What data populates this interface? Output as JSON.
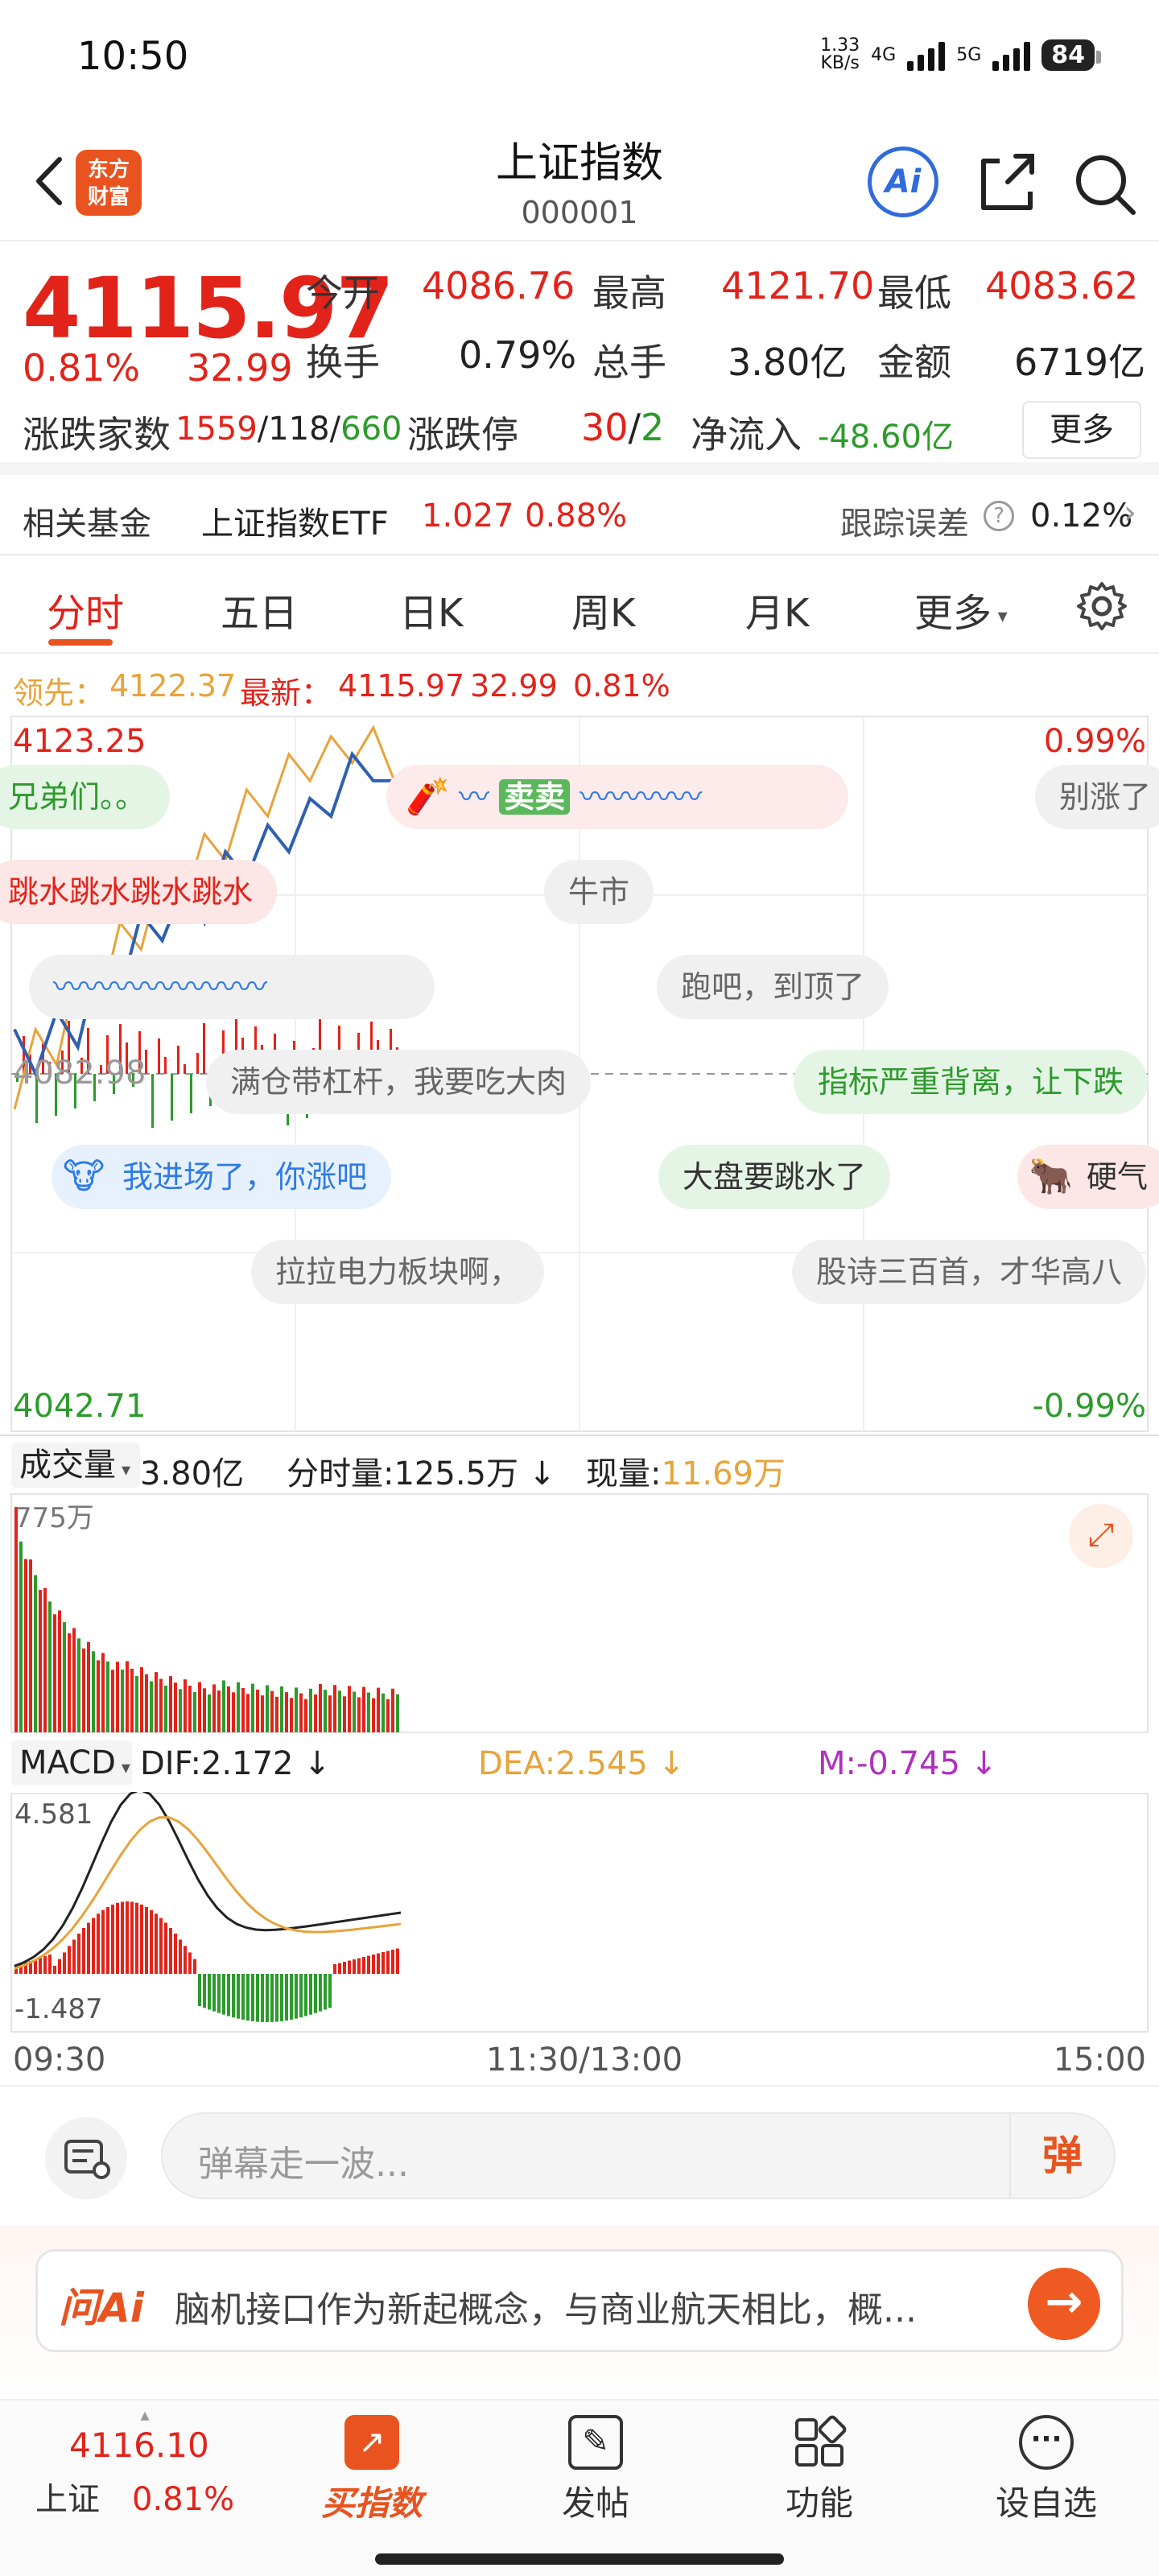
{
  "status_bar": {
    "time": "10:50",
    "net_speed": "1.33",
    "net_unit": "KB/s",
    "net1": "4G",
    "net2": "5G",
    "battery": "84"
  },
  "header": {
    "logo_line1": "东方",
    "logo_line2": "财富",
    "title": "上证指数",
    "code": "000001",
    "ai_label": "Ai"
  },
  "quote": {
    "price": "4115.97",
    "change_pct": "0.81%",
    "change": "32.99",
    "open_label": "今开",
    "open": "4086.76",
    "high_label": "最高",
    "high": "4121.70",
    "low_label": "最低",
    "low": "4083.62",
    "turnover_label": "换手",
    "turnover": "0.79%",
    "volume_label": "总手",
    "volume": "3.80亿",
    "amount_label": "金额",
    "amount": "6719亿",
    "breadth_label": "涨跌家数",
    "up": "1559",
    "flat": "118",
    "down": "660",
    "sep": "/",
    "limit_label": "涨跌停",
    "limit_up": "30",
    "limit_down": "2",
    "netflow_label": "净流入",
    "netflow": "-48.60亿",
    "more": "更多"
  },
  "fund": {
    "label": "相关基金",
    "name": "上证指数ETF",
    "price": "1.027",
    "pct": "0.88%",
    "err_label": "跟踪误差",
    "err": "0.12%"
  },
  "tabs": [
    {
      "label": "分时"
    },
    {
      "label": "五日"
    },
    {
      "label": "日K"
    },
    {
      "label": "周K"
    },
    {
      "label": "月K"
    },
    {
      "label": "更多"
    }
  ],
  "legend": {
    "lead_label": "领先：",
    "lead": "4122.37",
    "latest_label": "最新：",
    "latest": "4115.97",
    "chg": "32.99",
    "pct": "0.81%"
  },
  "main_chart": {
    "top": "4123.25",
    "top_pct": "0.99%",
    "mid": "4082.98",
    "bottom": "4042.71",
    "bottom_pct": "-0.99%"
  },
  "danmaku": [
    {
      "text": "兄弟们。。"
    },
    {
      "text": "卖卖"
    },
    {
      "text": "别涨了"
    },
    {
      "text": "跳水跳水跳水跳水"
    },
    {
      "text": "牛市"
    },
    {
      "text": "跑吧，到顶了"
    },
    {
      "text": "满仓带杠杆，我要吃大肉"
    },
    {
      "text": "指标严重背离，让下跌"
    },
    {
      "text": "我进场了，你涨吧"
    },
    {
      "text": "大盘要跳水了"
    },
    {
      "text": "硬气"
    },
    {
      "text": "拉拉电力板块啊，"
    },
    {
      "text": "股诗三百首，才华高八"
    }
  ],
  "volume": {
    "label": "成交量",
    "total": "3.80亿",
    "period_label": "分时量:",
    "period": "125.5万",
    "now_label": "现量:",
    "now": "11.69万",
    "max": "775万"
  },
  "macd": {
    "label": "MACD",
    "dif": "DIF:2.172",
    "dea": "DEA:2.545",
    "m": "M:-0.745",
    "max": "4.581",
    "min": "-1.487"
  },
  "time_axis": {
    "start": "09:30",
    "mid": "11:30/13:00",
    "end": "15:00"
  },
  "comment": {
    "placeholder": "弹幕走一波...",
    "dan": "弹"
  },
  "ai_bar": {
    "tag": "问Ai",
    "text": "脑机接口作为新起概念，与商业航天相比，概..."
  },
  "bottom_nav": {
    "index_price": "4116.10",
    "index_name": "上证",
    "index_pct": "0.81%",
    "buy": "买指数",
    "post": "发帖",
    "func": "功能",
    "watch": "设自选"
  },
  "chart_data": {
    "type": "line",
    "series": [
      {
        "values": [
          4079,
          4088,
          4084,
          4095,
          4090,
          4100,
          4097,
          4106,
          4102,
          4110,
          4107,
          4115,
          4112,
          4119,
          4116,
          4121,
          4118,
          4122,
          4116
        ]
      },
      {
        "values": [
          4088,
          4083,
          4090,
          4086,
          4096,
          4092,
          4101,
          4098,
          4104,
          4100,
          4108,
          4105,
          4111,
          4108,
          4114,
          4112,
          4119,
          4116,
          4116
        ]
      }
    ],
    "ylim": [
      4042.71,
      4123.25
    ]
  }
}
